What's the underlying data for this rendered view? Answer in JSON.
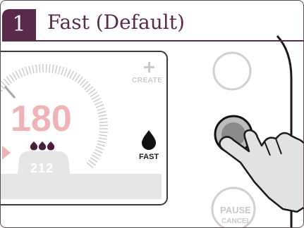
{
  "step": {
    "number": "1",
    "title": "Fast (Default)"
  },
  "display": {
    "create_label": "CREATE",
    "temperature": "180",
    "flame_level": 3,
    "secondary_temperature": "212",
    "mode_label": "FAST"
  },
  "buttons": {
    "pause_cancel_line1": "PAUSE",
    "pause_cancel_line2": "CANCEL"
  },
  "colors": {
    "brand": "#5a2a4b",
    "temperature": "#f0b3b5",
    "display_panel": "#e6e6e6"
  },
  "icons": {
    "create": "plus-icon",
    "mode": "water-drop-icon",
    "flames": "flame-icon",
    "pointer": "hand-pointer-icon"
  }
}
